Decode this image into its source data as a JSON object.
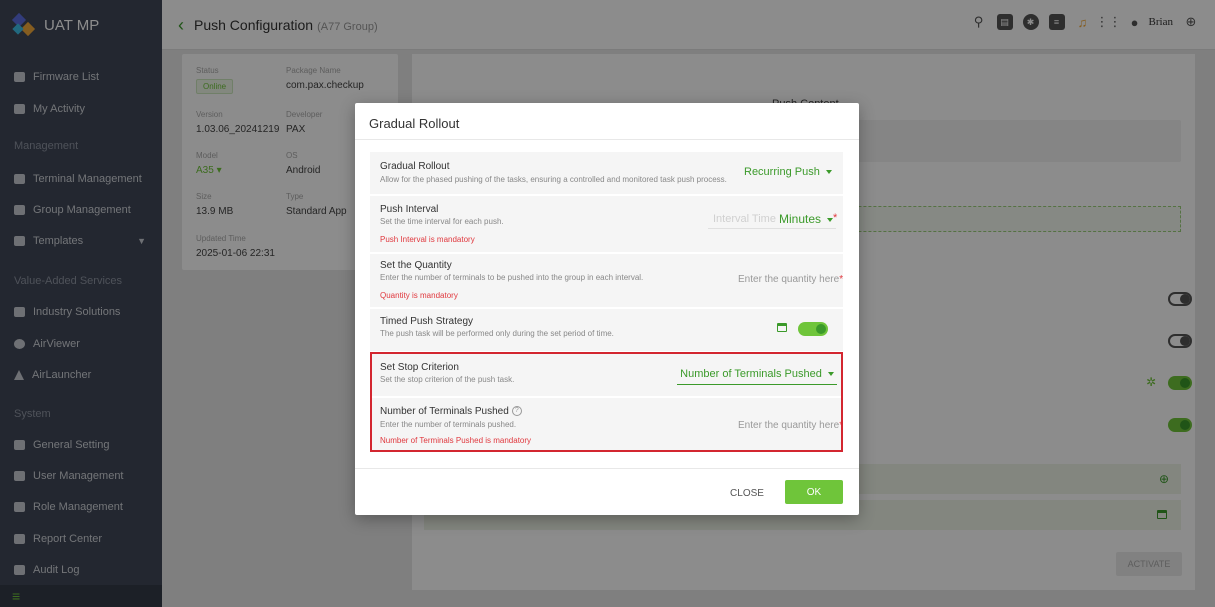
{
  "app": {
    "title": "UAT MP"
  },
  "header": {
    "breadcrumb_title": "Push Configuration",
    "breadcrumb_sub": "(A77 Group)",
    "user_name": "Brian"
  },
  "sidebar": {
    "items": [
      {
        "label": "Firmware List"
      },
      {
        "label": "My Activity"
      },
      {
        "label": "Terminal Management"
      },
      {
        "label": "Group Management"
      },
      {
        "label": "Templates"
      },
      {
        "label": "Industry Solutions"
      },
      {
        "label": "AirViewer"
      },
      {
        "label": "AirLauncher"
      },
      {
        "label": "General Setting"
      },
      {
        "label": "User Management"
      },
      {
        "label": "Role Management"
      },
      {
        "label": "Report Center"
      },
      {
        "label": "Audit Log"
      }
    ],
    "sections": [
      "Management",
      "Value-Added Services",
      "System"
    ]
  },
  "info": {
    "status_label": "Status",
    "status_value": "Online",
    "package_label": "Package Name",
    "package_value": "com.pax.checkup",
    "version_label": "Version",
    "version_value": "1.03.06_20241219",
    "developer_label": "Developer",
    "developer_value": "PAX",
    "model_label": "Model",
    "model_value": "A35",
    "os_label": "OS",
    "os_value": "Android",
    "size_label": "Size",
    "size_value": "13.9 MB",
    "type_label": "Type",
    "type_value": "Standard App",
    "updated_label": "Updated Time",
    "updated_value": "2025-01-06 22:31"
  },
  "background": {
    "push_content_title": "Push Content",
    "activate_label": "ACTIVATE"
  },
  "modal": {
    "title": "Gradual Rollout",
    "rollout": {
      "title": "Gradual Rollout",
      "desc": "Allow for the phased pushing of the tasks, ensuring a controlled and monitored task push process.",
      "value": "Recurring Push"
    },
    "interval": {
      "title": "Push Interval",
      "desc": "Set the time interval for each push.",
      "error": "Push Interval is mandatory",
      "placeholder": "Interval Time",
      "unit": "Minutes"
    },
    "quantity": {
      "title": "Set the Quantity",
      "desc": "Enter the number of terminals to be pushed into the group in each interval.",
      "error": "Quantity is mandatory",
      "placeholder": "Enter the quantity here"
    },
    "timed": {
      "title": "Timed Push Strategy",
      "desc": "The push task will be performed only during the set period of time.",
      "enabled": true
    },
    "stop": {
      "title": "Set Stop Criterion",
      "desc": "Set the stop criterion of the push task.",
      "value": "Number of Terminals Pushed"
    },
    "terminals": {
      "title": "Number of Terminals Pushed",
      "desc": "Enter the number of terminals pushed.",
      "error": "Number of Terminals Pushed is mandatory",
      "placeholder": "Enter the quantity here"
    },
    "close_label": "CLOSE",
    "ok_label": "OK"
  },
  "colors": {
    "accent": "#6fc53a",
    "accent_dark": "#3b9a2a",
    "error": "#e0383e",
    "sidebar": "#404858",
    "highlight": "#d32630"
  }
}
